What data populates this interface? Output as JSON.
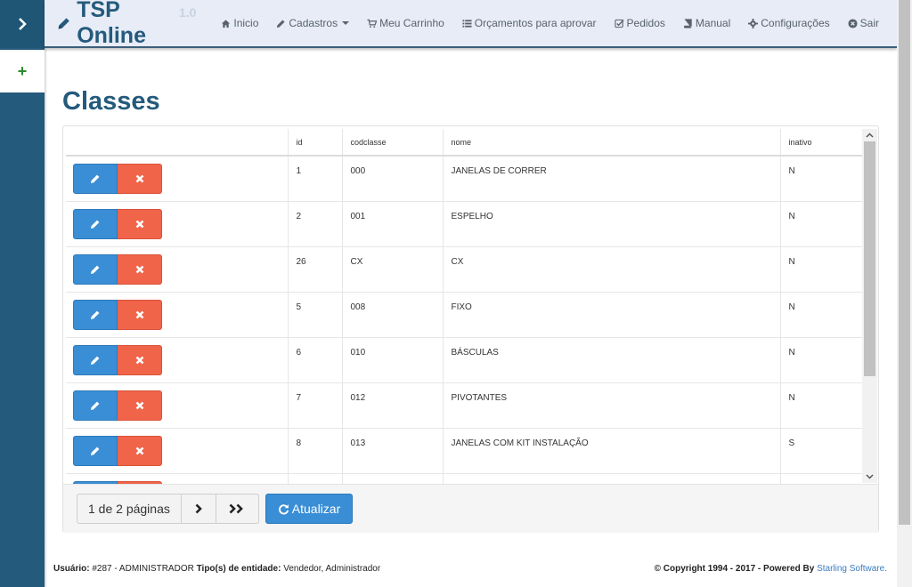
{
  "app": {
    "brand_title": "TSP Online",
    "brand_version": "1.0"
  },
  "nav": {
    "items": [
      {
        "label": "Inicio",
        "icon": "home-icon"
      },
      {
        "label": "Cadastros",
        "icon": "pencil-icon",
        "dropdown": true
      },
      {
        "label": "Meu Carrinho",
        "icon": "cart-icon"
      },
      {
        "label": "Orçamentos para aprovar",
        "icon": "list-icon"
      },
      {
        "label": "Pedidos",
        "icon": "check-square-icon"
      },
      {
        "label": "Manual",
        "icon": "book-icon"
      },
      {
        "label": "Configurações",
        "icon": "gear-icon"
      },
      {
        "label": "Sair",
        "icon": "close-circle-icon"
      }
    ]
  },
  "sidebar": {
    "toggle_icon": "chevron-right-icon",
    "add_label": "+"
  },
  "page": {
    "title": "Classes"
  },
  "table": {
    "columns": [
      "",
      "id",
      "codclasse",
      "nome",
      "inativo"
    ],
    "rows": [
      {
        "id": "1",
        "codclasse": "000",
        "nome": "JANELAS DE CORRER",
        "inativo": "N"
      },
      {
        "id": "2",
        "codclasse": "001",
        "nome": "ESPELHO",
        "inativo": "N"
      },
      {
        "id": "26",
        "codclasse": "CX",
        "nome": "CX",
        "inativo": "N"
      },
      {
        "id": "5",
        "codclasse": "008",
        "nome": "FIXO",
        "inativo": "N"
      },
      {
        "id": "6",
        "codclasse": "010",
        "nome": "BÁSCULAS",
        "inativo": "N"
      },
      {
        "id": "7",
        "codclasse": "012",
        "nome": "PIVOTANTES",
        "inativo": "N"
      },
      {
        "id": "8",
        "codclasse": "013",
        "nome": "JANELAS COM KIT INSTALAÇÃO",
        "inativo": "S"
      },
      {
        "id": "",
        "codclasse": "",
        "nome": "",
        "inativo": ""
      }
    ]
  },
  "pager": {
    "info": "1 de 2 páginas",
    "refresh_label": "Atualizar"
  },
  "footer": {
    "user_label": "Usuário:",
    "user_value": "#287 - ADMINISTRADOR",
    "entity_label": "Tipo(s) de entidade:",
    "entity_value": "Vendedor, Administrador",
    "copyright": "© Copyright 1994 - 2017 - Powered By",
    "powered_link": "Starling Software",
    "period": "."
  },
  "colors": {
    "brand": "#245a7c",
    "edit_button": "#3a8ed5",
    "delete_button": "#f06449",
    "navbar_bg": "#e7ecf7"
  }
}
